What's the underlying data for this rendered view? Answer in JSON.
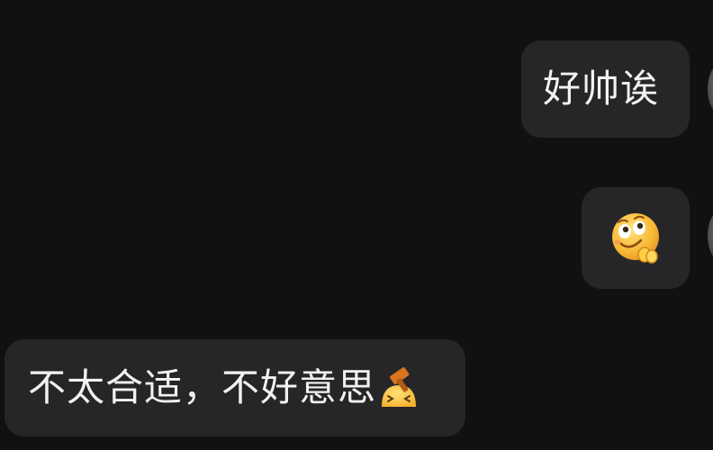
{
  "messages": [
    {
      "id": "msg1",
      "side": "right",
      "text": "好帅诶"
    },
    {
      "id": "msg2",
      "side": "right",
      "sticker": "hands-together-smiling-emoji"
    },
    {
      "id": "msg3",
      "side": "left",
      "text": "不太合适，不好意思",
      "trailing_emoji": "hammer-face-emoji"
    }
  ],
  "colors": {
    "background": "#111113",
    "bubble": "#262628",
    "text": "#f2f2f2"
  }
}
